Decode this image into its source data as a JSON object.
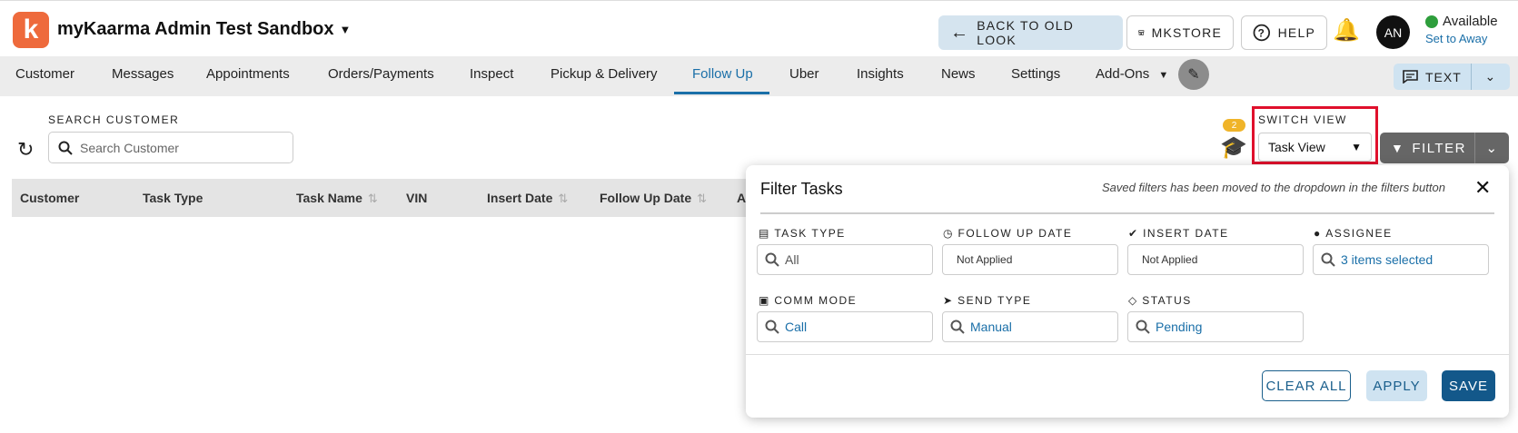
{
  "header": {
    "logo_letter": "k",
    "dealer_name": "myKaarma Admin Test Sandbox",
    "back_label": "BACK TO OLD LOOK",
    "mkstore_label": "MKSTORE",
    "help_label": "HELP",
    "avatar_initials": "AN",
    "status_label": "Available",
    "away_link": "Set to Away"
  },
  "nav": {
    "items": [
      "Customer",
      "Messages",
      "Appointments",
      "Orders/Payments",
      "Inspect",
      "Pickup & Delivery",
      "Follow Up",
      "Uber",
      "Insights",
      "News",
      "Settings",
      "Add-Ons"
    ],
    "active": "Follow Up",
    "text_label": "TEXT"
  },
  "search": {
    "label": "SEARCH CUSTOMER",
    "placeholder": "Search Customer"
  },
  "training_badge": "2",
  "switch_view": {
    "label": "SWITCH VIEW",
    "value": "Task View"
  },
  "filter_label": "FILTER",
  "table": {
    "columns": [
      "Customer",
      "Task Type",
      "Task Name",
      "VIN",
      "Insert Date",
      "Follow Up Date",
      "A"
    ]
  },
  "filter_panel": {
    "title": "Filter Tasks",
    "note": "Saved filters has been moved to the dropdown in the filters button",
    "fields": {
      "task_type": {
        "label": "TASK TYPE",
        "value": "All"
      },
      "follow_up_date": {
        "label": "FOLLOW UP DATE",
        "value": "Not Applied"
      },
      "insert_date": {
        "label": "INSERT DATE",
        "value": "Not Applied"
      },
      "assignee": {
        "label": "ASSIGNEE",
        "value": "3 items selected"
      },
      "comm_mode": {
        "label": "COMM MODE",
        "value": "Call"
      },
      "send_type": {
        "label": "SEND TYPE",
        "value": "Manual"
      },
      "status": {
        "label": "STATUS",
        "value": "Pending"
      }
    },
    "clear_label": "CLEAR ALL",
    "apply_label": "APPLY",
    "save_label": "SAVE"
  }
}
